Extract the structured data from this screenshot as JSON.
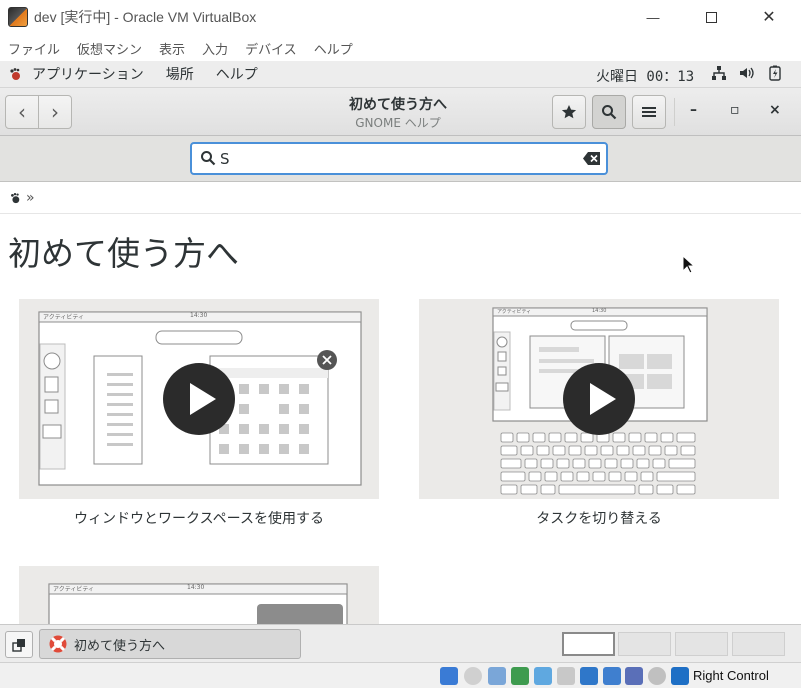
{
  "host_window": {
    "title": "dev [実行中] - Oracle VM VirtualBox",
    "minimize": "—",
    "close": "✕"
  },
  "vbox_menu": [
    "ファイル",
    "仮想マシン",
    "表示",
    "入力",
    "デバイス",
    "ヘルプ"
  ],
  "gnome_topbar": {
    "applications": "アプリケーション",
    "places": "場所",
    "help": "ヘルプ",
    "clock": "火曜日 00：13",
    "tray_icons": [
      "network-icon",
      "volume-icon",
      "battery-icon"
    ]
  },
  "headerbar": {
    "title": "初めて使う方へ",
    "subtitle": "GNOME ヘルプ",
    "back": "‹",
    "forward": "›",
    "minimize": "–",
    "maximize": "▫",
    "close": "×"
  },
  "search": {
    "value": "S",
    "placeholder": ""
  },
  "breadcrumb": {
    "separator": "»"
  },
  "page": {
    "title": "初めて使う方へ",
    "cards": [
      {
        "caption": "ウィンドウとワークスペースを使用する",
        "video_clock": "14:30",
        "video_label": "アクティビティ"
      },
      {
        "caption": "タスクを切り替える",
        "video_clock": "14:30",
        "video_label": "アクティビティ"
      },
      {
        "caption": "",
        "video_clock": "14:30",
        "video_label": "アクティビティ"
      }
    ]
  },
  "taskbar": {
    "task_label": "初めて使う方へ",
    "workspaces": 4,
    "active_workspace": 1
  },
  "vbox_status": {
    "right_control": "Right Control"
  },
  "colors": {
    "accent": "#4a90d9",
    "card_bg": "#ebeae8",
    "play_button": "#2b2b2b"
  }
}
